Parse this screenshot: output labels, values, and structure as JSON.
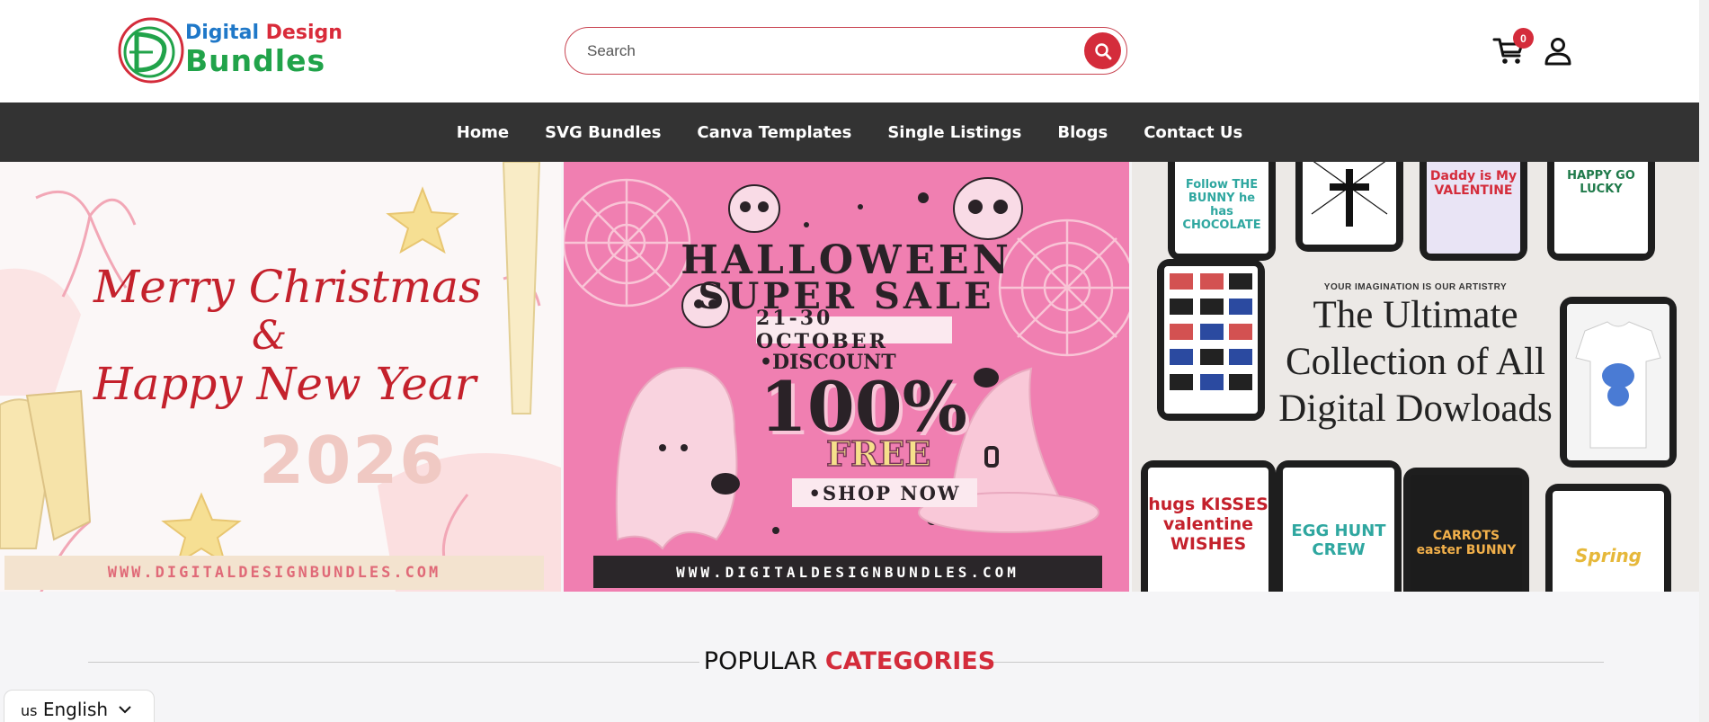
{
  "header": {
    "logo": {
      "line1_word1": "Digital",
      "line1_word2": "Design",
      "line2": "Bundles"
    },
    "search": {
      "placeholder": "Search"
    },
    "cart": {
      "count": "0"
    }
  },
  "nav": {
    "items": [
      {
        "label": "Home"
      },
      {
        "label": "SVG Bundles"
      },
      {
        "label": "Canva Templates"
      },
      {
        "label": "Single Listings"
      },
      {
        "label": "Blogs"
      },
      {
        "label": "Contact Us"
      }
    ]
  },
  "banners": {
    "christmas": {
      "line1": "Merry Christmas",
      "amp": "&",
      "line2": "Happy New Year",
      "year": "2026",
      "url": "WWW.DIGITALDESIGNBUNDLES.COM"
    },
    "halloween": {
      "title1": "HALLOWEEN",
      "title2": "SUPER SALE",
      "dates": "21-30 OCTOBER",
      "discount": "•DISCOUNT",
      "percent": "100%",
      "free": "FREE",
      "shop": "•SHOP NOW",
      "url": "WWW.DIGITALDESIGNBUNDLES.COM"
    },
    "collection": {
      "kicker": "YOUR IMAGINATION IS OUR ARTISTRY",
      "line1": "The Ultimate",
      "line2": "Collection of All",
      "line3": "Digital Dowloads",
      "tiles": {
        "bunny": "Follow THE BUNNY he has CHOCOLATE",
        "valentine": "Daddy is My VALENTINE",
        "lucky": "HAPPY GO LUCKY",
        "kisses": "hugs KISSES valentine WISHES",
        "egg": "EGG HUNT CREW",
        "carrots": "CARROTS easter BUNNY",
        "spring": "Spring"
      }
    }
  },
  "popular": {
    "title_plain": "POPULAR",
    "title_highlight": "CATEGORIES"
  },
  "language": {
    "code": "us",
    "label": "English"
  },
  "colors": {
    "accent": "#d42c3b",
    "nav_bg": "#333333",
    "halloween_pink": "#f07fb1",
    "logo_green": "#21a34a",
    "logo_blue": "#1f78c8"
  }
}
